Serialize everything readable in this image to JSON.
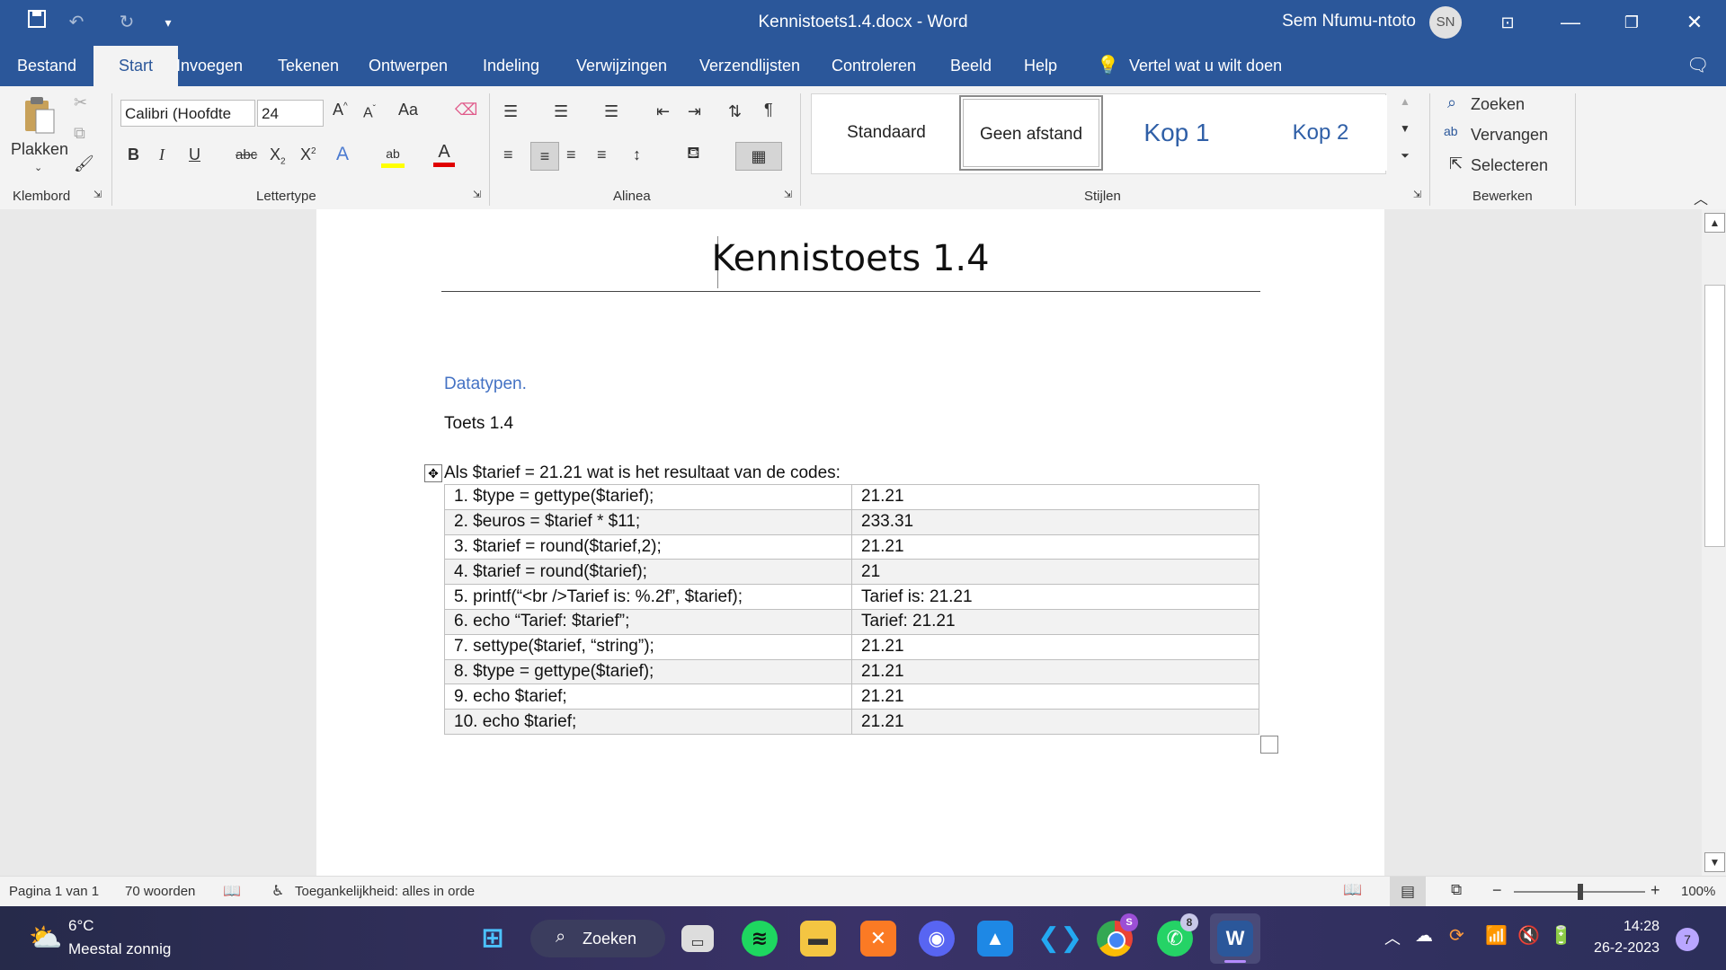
{
  "window": {
    "doc_title": "Kennistoets1.4.docx  -  Word",
    "user_name": "Sem Nfumu-ntoto",
    "user_initials": "SN"
  },
  "tabs": [
    "Bestand",
    "Start",
    "Invoegen",
    "Tekenen",
    "Ontwerpen",
    "Indeling",
    "Verwijzingen",
    "Verzendlijsten",
    "Controleren",
    "Beeld",
    "Help"
  ],
  "tellme": "Vertel wat u wilt doen",
  "ribbon": {
    "paste_label": "Plakken",
    "font_name": "Calibri (Hoofdte",
    "font_size": "24",
    "case_label": "Aa",
    "groups": {
      "clipboard": "Klembord",
      "font": "Lettertype",
      "paragraph": "Alinea",
      "styles": "Stijlen",
      "editing": "Bewerken"
    },
    "styles": [
      "Standaard",
      "Geen afstand",
      "Kop 1",
      "Kop 2"
    ],
    "editing": {
      "find": "Zoeken",
      "replace": "Vervangen",
      "select": "Selecteren"
    },
    "colors": {
      "highlight": "#ffff00",
      "font": "#e00000"
    }
  },
  "document": {
    "title": "Kennistoets 1.4",
    "heading": "Datatypen.",
    "subtitle": "Toets 1.4",
    "question": "Als $tarief = 21.21 wat is het resultaat van de codes:",
    "rows": [
      {
        "code": "1. $type = gettype($tarief);",
        "result": "21.21"
      },
      {
        "code": "2. $euros = $tarief * $11;",
        "result": "233.31"
      },
      {
        "code": "3. $tarief = round($tarief,2);",
        "result": "21.21"
      },
      {
        "code": "4. $tarief = round($tarief);",
        "result": "21"
      },
      {
        "code": "5. printf(“<br />Tarief is: %.2f”, $tarief);",
        "result": "Tarief is: 21.21"
      },
      {
        "code": "6. echo “Tarief: $tarief”;",
        "result": "Tarief: 21.21"
      },
      {
        "code": "7. settype($tarief, “string”);",
        "result": "21.21"
      },
      {
        "code": "8. $type = gettype($tarief);",
        "result": "21.21"
      },
      {
        "code": "9. echo $tarief;",
        "result": "21.21"
      },
      {
        "code": "10. echo $tarief;",
        "result": "21.21"
      }
    ]
  },
  "status": {
    "page": "Pagina 1 van 1",
    "words": "70 woorden",
    "accessibility": "Toegankelijkheid: alles in orde",
    "zoom": "100%"
  },
  "taskbar": {
    "temp": "6°C",
    "weather": "Meestal zonnig",
    "search": "Zoeken",
    "time": "14:28",
    "date": "26-2-2023",
    "notifications": "7",
    "whatsapp_badge": "8",
    "chrome_badge": "S"
  }
}
